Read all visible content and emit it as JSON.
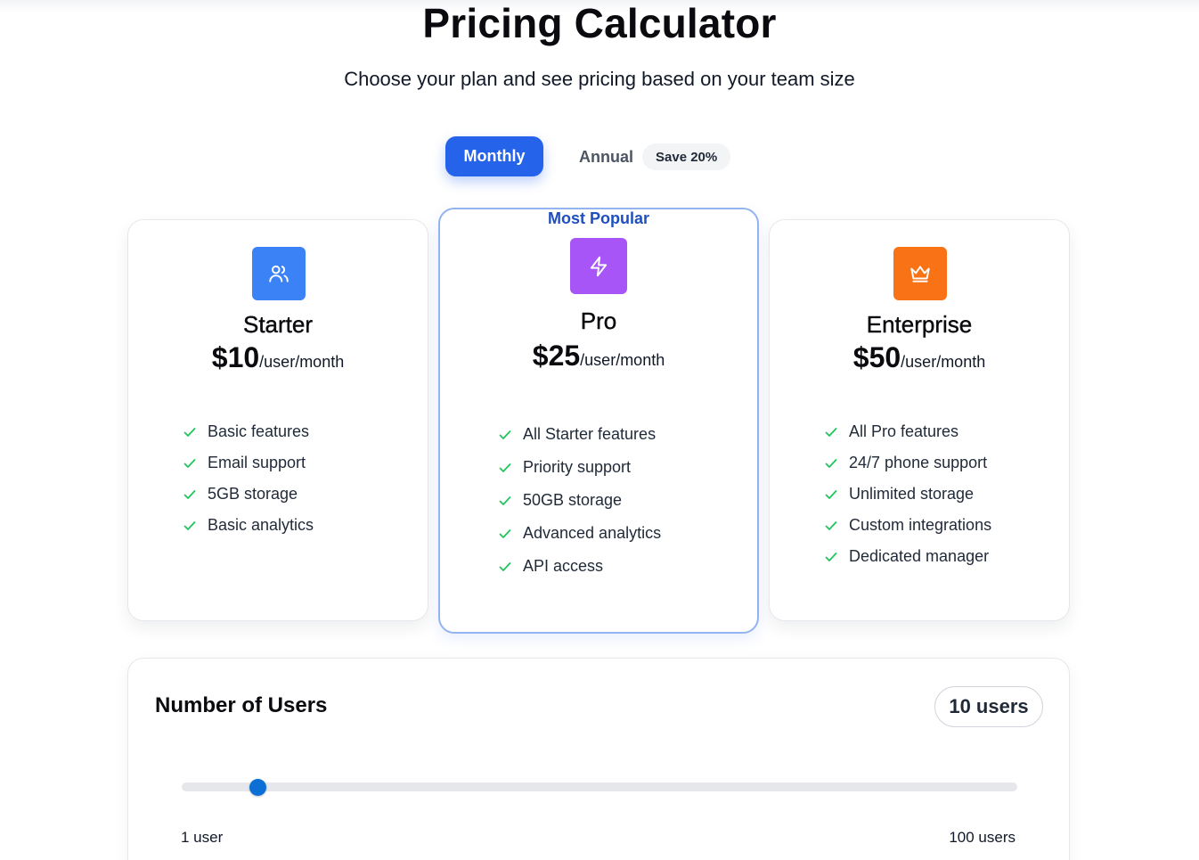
{
  "header": {
    "title": "Pricing Calculator",
    "subtitle": "Choose your plan and see pricing based on your team size"
  },
  "billing": {
    "monthly_label": "Monthly",
    "annual_label": "Annual",
    "save_badge": "Save 20%",
    "selected": "Monthly"
  },
  "colors": {
    "accent": "#2563eb",
    "starter_icon_bg": "#3b82f6",
    "pro_icon_bg": "#a855f7",
    "enterprise_icon_bg": "#f97316",
    "check": "#22c55e",
    "popular_border": "#93b4ee",
    "slider_thumb": "#0b6fd6"
  },
  "plans": [
    {
      "name": "Starter",
      "icon": "users-icon",
      "price": "$10",
      "unit": "/user/month",
      "features": [
        "Basic features",
        "Email support",
        "5GB storage",
        "Basic analytics"
      ]
    },
    {
      "name": "Pro",
      "icon": "lightning-icon",
      "badge": "Most Popular",
      "price": "$25",
      "unit": "/user/month",
      "features": [
        "All Starter features",
        "Priority support",
        "50GB storage",
        "Advanced analytics",
        "API access"
      ]
    },
    {
      "name": "Enterprise",
      "icon": "crown-icon",
      "price": "$50",
      "unit": "/user/month",
      "features": [
        "All Pro features",
        "24/7 phone support",
        "Unlimited storage",
        "Custom integrations",
        "Dedicated manager"
      ]
    }
  ],
  "users": {
    "title": "Number of Users",
    "count_label": "10 users",
    "value": 10,
    "min": 1,
    "max": 100,
    "min_label": "1 user",
    "max_label": "100 users"
  }
}
